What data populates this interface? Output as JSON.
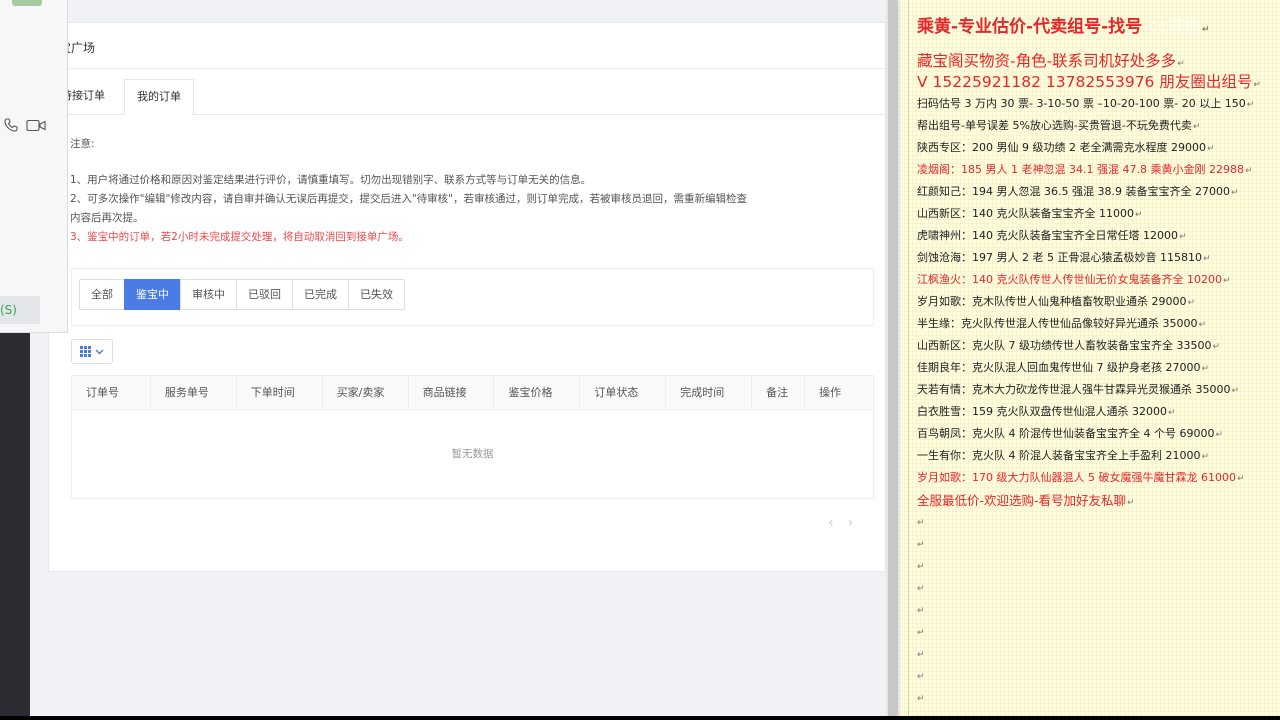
{
  "web": {
    "card_title": "宝广场",
    "tabs": [
      {
        "label": "待接订单"
      },
      {
        "label": "我的订单"
      }
    ],
    "notice_title": "注意:",
    "notice_lines": [
      "1、用户将通过价格和原因对鉴定结果进行评价，请慎重填写。切勿出现错别字、联系方式等与订单无关的信息。",
      "2、可多次操作\"编辑\"修改内容，请自审并确认无误后再提交，提交后进入\"待审核\"，若审核通过，则订单完成，若被审核员退回，需重新编辑检查",
      "内容后再次提。",
      "3、鉴宝中的订单，若2小时未完成提交处理，将自动取消回到接单广场。"
    ],
    "filters": [
      "全部",
      "鉴宝中",
      "审核中",
      "已驳回",
      "已完成",
      "已失效"
    ],
    "active_filter": "鉴宝中",
    "columns": [
      "订单号",
      "服务单号",
      "下单时间",
      "买家/卖家",
      "商品链接",
      "鉴宝价格",
      "订单状态",
      "完成时间",
      "备注",
      "操作"
    ],
    "empty_text": "暂无数据",
    "pager": {
      "prev": "‹",
      "next": "›"
    }
  },
  "chat": {
    "status_label": "(S)"
  },
  "doc": {
    "title_main": "乘黄-专业估价-代卖组号-找号",
    "title_watermark": "-cc直播",
    "pilcrow": "↵",
    "lines": [
      {
        "text": "藏宝阁买物资-角色-联系司机好处多多",
        "style": "red big"
      },
      {
        "text": "V 15225921182      13782553976 朋友圈出组号",
        "style": "red big"
      },
      {
        "text": "扫码估号 3 万内 30 票- 3-10-50 票  –10-20-100 票- 20 以上 150",
        "style": ""
      },
      {
        "text": "帮出组号-单号误差 5%放心选购-买贵管退-不玩免费代卖",
        "style": ""
      },
      {
        "text": "陕西专区：200 男仙 9 级功绩 2 老全满需克水程度 29000",
        "style": ""
      },
      {
        "text": "凌烟阁：185 男人 1 老神忽混 34.1 强混 47.8 乘黄小金刚 22988",
        "style": "red"
      },
      {
        "text": "红颜知己：194 男人忽混 36.5 强混 38.9 装备宝宝齐全 27000",
        "style": ""
      },
      {
        "text": "山西新区：140 克火队装备宝宝齐全 11000",
        "style": ""
      },
      {
        "text": "虎啸神州：140 克火队装备宝宝齐全日常任塔 12000",
        "style": ""
      },
      {
        "text": "剑蚀沧海：197 男人 2 老 5 正骨混心猿孟极妙音 115810",
        "style": ""
      },
      {
        "text": "江枫渔火：140 克火队传世人传世仙无价女鬼装备齐全 10200",
        "style": "red"
      },
      {
        "text": "岁月如歌：克木队传世人仙鬼种植畜牧职业通杀 29000",
        "style": ""
      },
      {
        "text": "半生缘：克火队传世混人传世仙品像较好异光通杀 35000",
        "style": ""
      },
      {
        "text": "山西新区：克火队 7 级功绩传世人畜牧装备宝宝齐全 33500",
        "style": ""
      },
      {
        "text": "佳期良年：克火队混人回血鬼传世仙 7 级护身老孩 27000",
        "style": ""
      },
      {
        "text": "天若有情：克木大力砍龙传世混人强牛甘霖异光灵猴通杀 35000",
        "style": ""
      },
      {
        "text": "白衣胜雪：159 克火队双盘传世仙混人通杀 32000",
        "style": ""
      },
      {
        "text": "百鸟朝凤：克火队 4 阶混传世仙装备宝宝齐全 4 个号 69000",
        "style": ""
      },
      {
        "text": "一生有你：克火队 4 阶混人装备宝宝齐全上手盈利 21000",
        "style": ""
      },
      {
        "text": "岁月如歌：170 级大力队仙器混人 5 破女魔强牛魔甘霖龙 61000",
        "style": "red"
      },
      {
        "text": "全服最低价-欢迎选购-看号加好友私聊",
        "style": "red big-ish"
      }
    ]
  }
}
